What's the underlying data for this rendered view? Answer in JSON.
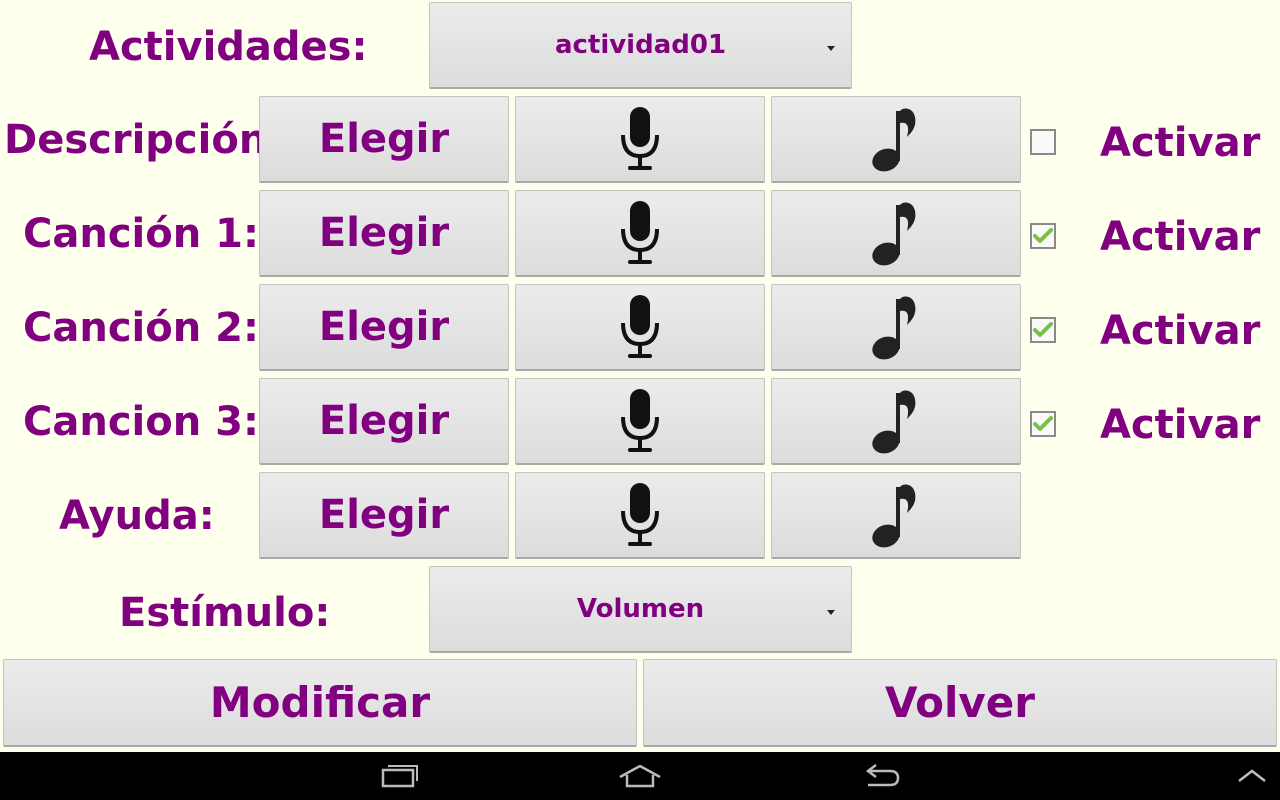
{
  "activities": {
    "label": "Actividades:",
    "selected": "actividad01"
  },
  "rows": [
    {
      "label": "Descripción:",
      "choose_label": "Elegir",
      "activate_label": "Activar",
      "checked": false
    },
    {
      "label": "Canción 1:",
      "choose_label": "Elegir",
      "activate_label": "Activar",
      "checked": true
    },
    {
      "label": "Canción 2:",
      "choose_label": "Elegir",
      "activate_label": "Activar",
      "checked": true
    },
    {
      "label": "Cancion 3:",
      "choose_label": "Elegir",
      "activate_label": "Activar",
      "checked": true
    },
    {
      "label": "Ayuda:",
      "choose_label": "Elegir"
    }
  ],
  "stimulus": {
    "label": "Estímulo:",
    "selected": "Volumen"
  },
  "actions": {
    "modify_label": "Modificar",
    "back_label": "Volver"
  },
  "icons": {
    "record": "microphone-icon",
    "play": "music-note-icon",
    "checked": "checkmark-icon"
  },
  "colors": {
    "accent": "#800080",
    "background": "#ffffee",
    "check": "#7ac043"
  }
}
